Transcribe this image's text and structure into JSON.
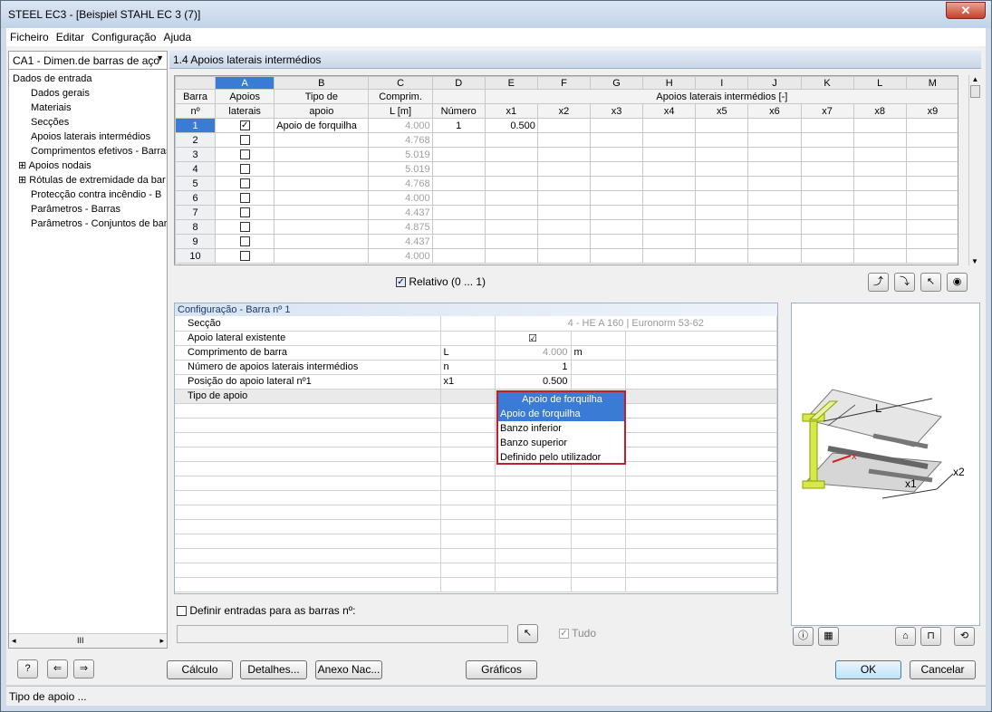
{
  "window": {
    "title": "STEEL EC3 - [Beispiel STAHL EC 3 (7)]",
    "close": "✕"
  },
  "menu": [
    "Ficheiro",
    "Editar",
    "Configuração",
    "Ajuda"
  ],
  "nav": {
    "selector": "CA1 - Dimen.de barras de aço",
    "tree": [
      "Dados de entrada",
      "Dados gerais",
      "Materiais",
      "Secções",
      "Apoios laterais intermédios",
      "Comprimentos efetivos - Barras",
      "Apoios nodais",
      "Rótulas de extremidade da bar",
      "Protecção contra incêndio - B",
      "Parâmetros - Barras",
      "Parâmetros - Conjuntos de bar"
    ],
    "scroll_thumb": "III"
  },
  "section_title": "1.4 Apoios laterais intermédios",
  "grid": {
    "letters": [
      "A",
      "B",
      "C",
      "D",
      "E",
      "F",
      "G",
      "H",
      "I",
      "J",
      "K",
      "L",
      "M"
    ],
    "head1": [
      "Barra",
      "Apoios",
      "Tipo de",
      "Comprim.",
      "",
      "Apoios laterais intermédios [-]"
    ],
    "head2": [
      "nº",
      "laterais",
      "apoio",
      "L [m]",
      "Número"
    ],
    "x_labels": [
      "x1",
      "x2",
      "x3",
      "x4",
      "x5",
      "x6",
      "x7",
      "x8",
      "x9"
    ],
    "rows": [
      {
        "n": "1",
        "checked": true,
        "tipo": "Apoio de forquilha",
        "L": "4.000",
        "num": "1",
        "x1": "0.500"
      },
      {
        "n": "2",
        "checked": false,
        "tipo": "",
        "L": "4.768",
        "num": "",
        "x1": ""
      },
      {
        "n": "3",
        "checked": false,
        "tipo": "",
        "L": "5.019",
        "num": "",
        "x1": ""
      },
      {
        "n": "4",
        "checked": false,
        "tipo": "",
        "L": "5.019",
        "num": "",
        "x1": ""
      },
      {
        "n": "5",
        "checked": false,
        "tipo": "",
        "L": "4.768",
        "num": "",
        "x1": ""
      },
      {
        "n": "6",
        "checked": false,
        "tipo": "",
        "L": "4.000",
        "num": "",
        "x1": ""
      },
      {
        "n": "7",
        "checked": false,
        "tipo": "",
        "L": "4.437",
        "num": "",
        "x1": ""
      },
      {
        "n": "8",
        "checked": false,
        "tipo": "",
        "L": "4.875",
        "num": "",
        "x1": ""
      },
      {
        "n": "9",
        "checked": false,
        "tipo": "",
        "L": "4.437",
        "num": "",
        "x1": ""
      },
      {
        "n": "10",
        "checked": false,
        "tipo": "",
        "L": "4.000",
        "num": "",
        "x1": ""
      }
    ]
  },
  "relativo_label": "Relativo (0 ... 1)",
  "config": {
    "title": "Configuração - Barra nº 1",
    "rows": [
      {
        "label": "Secção",
        "sym": "",
        "value": "4 - HE A 160 | Euronorm 53-62",
        "unit": ""
      },
      {
        "label": "Apoio lateral existente",
        "sym": "",
        "value": "☑",
        "unit": ""
      },
      {
        "label": "Comprimento de barra",
        "sym": "L",
        "value": "4.000",
        "unit": "m"
      },
      {
        "label": "Número de apoios laterais intermédios",
        "sym": "n",
        "value": "1",
        "unit": ""
      },
      {
        "label": "Posição do apoio lateral nº1",
        "sym": "x1",
        "value": "0.500",
        "unit": ""
      },
      {
        "label": "Tipo de apoio",
        "sym": "",
        "value": "",
        "unit": ""
      }
    ],
    "dropdown": {
      "current": "Apoio de forquilha",
      "options": [
        "Apoio de forquilha",
        "Banzo inferior",
        "Banzo superior",
        "Definido pelo utilizador"
      ]
    }
  },
  "define_label": "Definir entradas para as barras nº:",
  "tudo_label": "Tudo",
  "diagram_labels": {
    "L": "L",
    "x": "x",
    "x1": "x1",
    "x2": "x2"
  },
  "buttons": {
    "calc": "Cálculo",
    "details": "Detalhes...",
    "annex": "Anexo Nac...",
    "graphics": "Gráficos",
    "ok": "OK",
    "cancel": "Cancelar"
  },
  "status": "Tipo de apoio ..."
}
